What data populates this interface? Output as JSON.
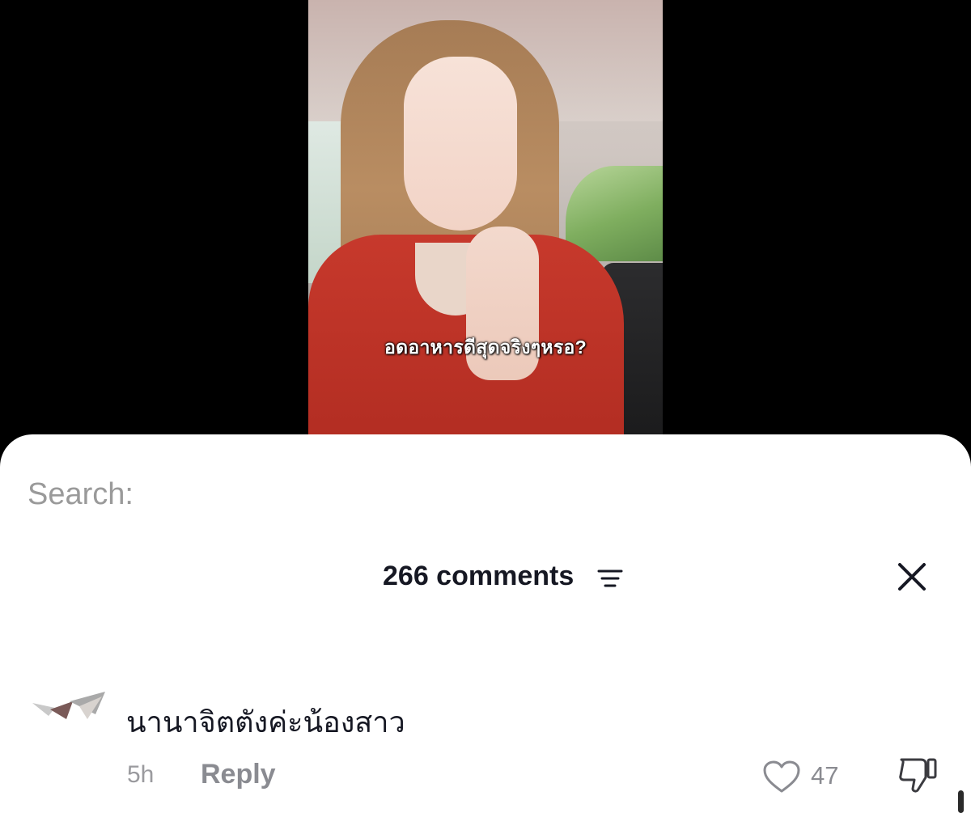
{
  "video": {
    "subtitle": "อดอาหารดีสุดจริงๆหรอ?"
  },
  "search": {
    "ghost_text": "Search:"
  },
  "comments_panel": {
    "count_label": "266 comments",
    "filter_icon": "filter-lines-icon",
    "close_icon": "close-icon"
  },
  "comments": [
    {
      "text": "นานาจิตตังค่ะน้องสาว",
      "time": "5h",
      "reply_label": "Reply",
      "likes": "47"
    }
  ],
  "colors": {
    "text_primary": "#161823",
    "text_secondary": "#8a8b91",
    "sheet_bg": "#ffffff",
    "backdrop": "#000000"
  }
}
